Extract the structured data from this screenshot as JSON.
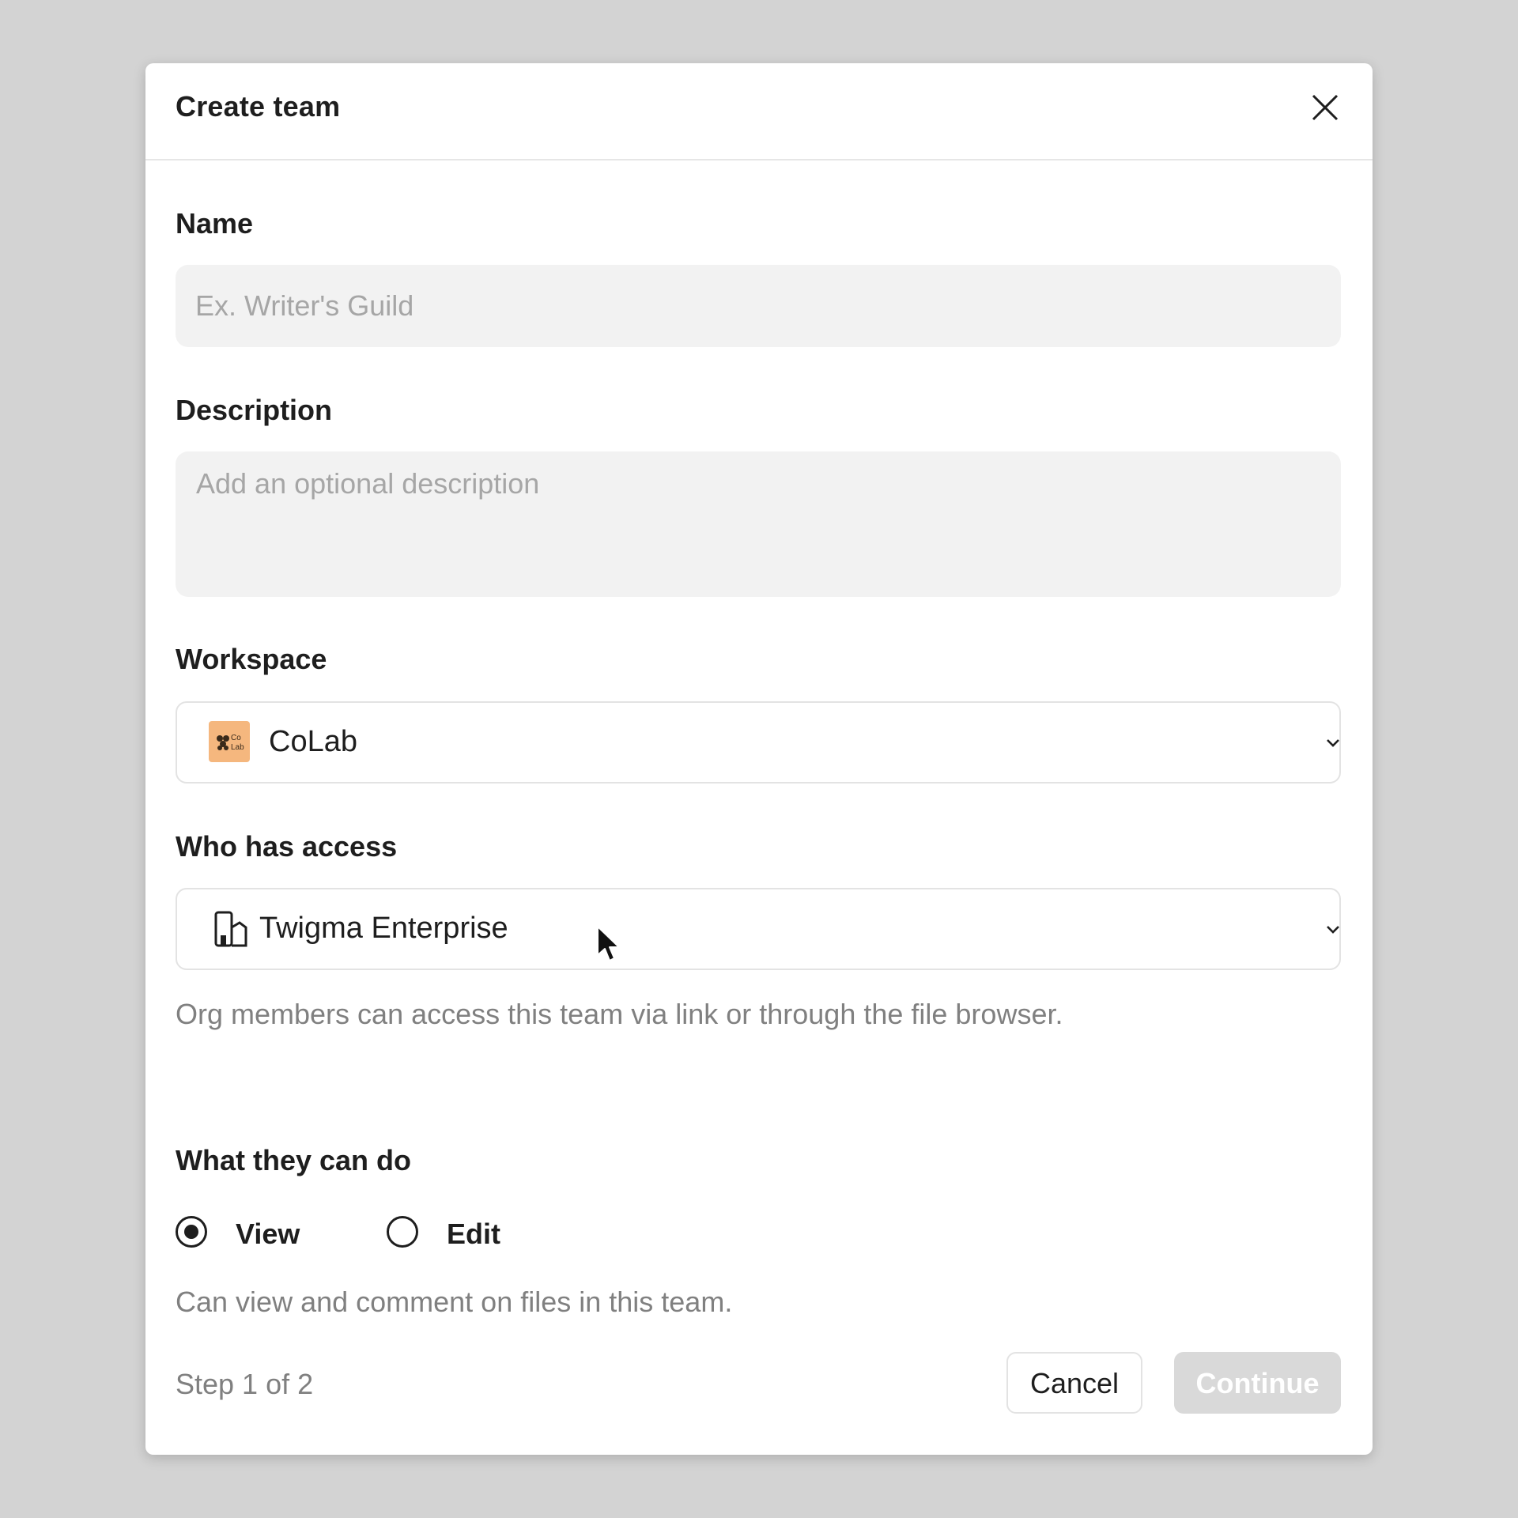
{
  "dialog": {
    "title": "Create team",
    "close_icon": "close-icon"
  },
  "name_field": {
    "label": "Name",
    "value": "",
    "placeholder": "Ex. Writer's Guild"
  },
  "description_field": {
    "label": "Description",
    "value": "",
    "placeholder": "Add an optional description"
  },
  "workspace": {
    "label": "Workspace",
    "selected": "CoLab",
    "logo_icon": "colab-logo-icon",
    "logo_color": "#f5b77e"
  },
  "access": {
    "label": "Who has access",
    "selected": "Twigma Enterprise",
    "icon": "organization-icon",
    "helper": "Org members can access this team via link or through the file browser."
  },
  "permissions": {
    "label": "What they can do",
    "options": [
      {
        "label": "View",
        "checked": true
      },
      {
        "label": "Edit",
        "checked": false
      }
    ],
    "helper": "Can view and comment on files in this team."
  },
  "footer": {
    "step": "Step 1 of 2",
    "cancel_label": "Cancel",
    "continue_label": "Continue"
  }
}
